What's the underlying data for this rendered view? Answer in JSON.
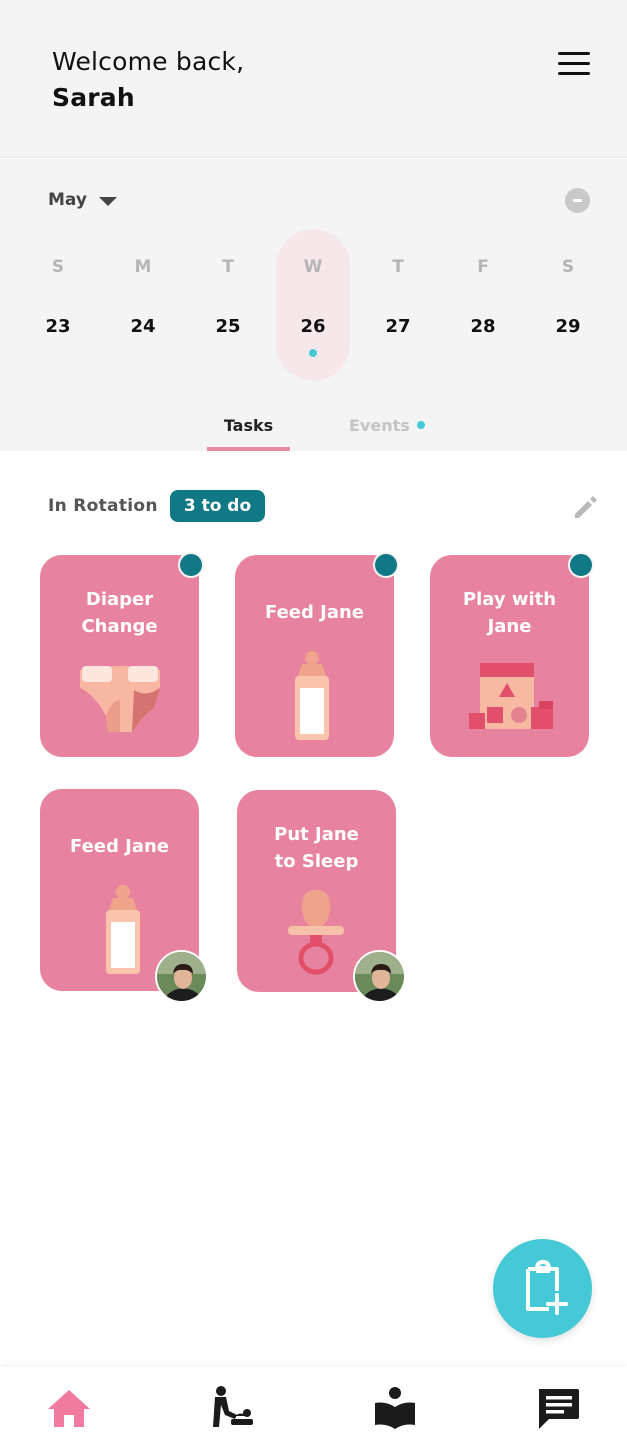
{
  "header": {
    "greeting": "Welcome back,",
    "user_name": "Sarah"
  },
  "calendar": {
    "month": "May",
    "days": [
      {
        "dow": "S",
        "num": "23"
      },
      {
        "dow": "M",
        "num": "24"
      },
      {
        "dow": "T",
        "num": "25"
      },
      {
        "dow": "W",
        "num": "26",
        "selected": true,
        "has_event": true
      },
      {
        "dow": "T",
        "num": "27"
      },
      {
        "dow": "F",
        "num": "28"
      },
      {
        "dow": "S",
        "num": "29"
      }
    ]
  },
  "tabs": [
    {
      "label": "Tasks",
      "active": true
    },
    {
      "label": "Events",
      "has_indicator": true
    }
  ],
  "rotation": {
    "label": "In Rotation",
    "badge": "3 to do"
  },
  "tasks": [
    {
      "title": "Diaper\nChange",
      "icon": "diaper-icon",
      "pending": true
    },
    {
      "title": "Feed Jane",
      "icon": "bottle-icon",
      "pending": true
    },
    {
      "title": "Play with\nJane",
      "icon": "blocks-icon",
      "pending": true
    },
    {
      "title": "Feed Jane",
      "icon": "bottle-icon",
      "assignee": true
    },
    {
      "title": "Put Jane\nto Sleep",
      "icon": "pacifier-icon",
      "assignee": true
    }
  ],
  "icons": {
    "menu": "hamburger-icon",
    "collapse": "minus-circle-icon",
    "edit": "pencil-icon",
    "fab": "add-task-clipboard-icon",
    "nav": [
      "home-icon",
      "baby-changing-icon",
      "reading-icon",
      "chat-icon"
    ]
  },
  "colors": {
    "card": "#e7829f",
    "badge": "#117885",
    "accent": "#45c9d6",
    "tab_underline": "#e88aa3",
    "selected_day_bg": "#f6e7ea",
    "nav_active": "#f07aa0"
  }
}
